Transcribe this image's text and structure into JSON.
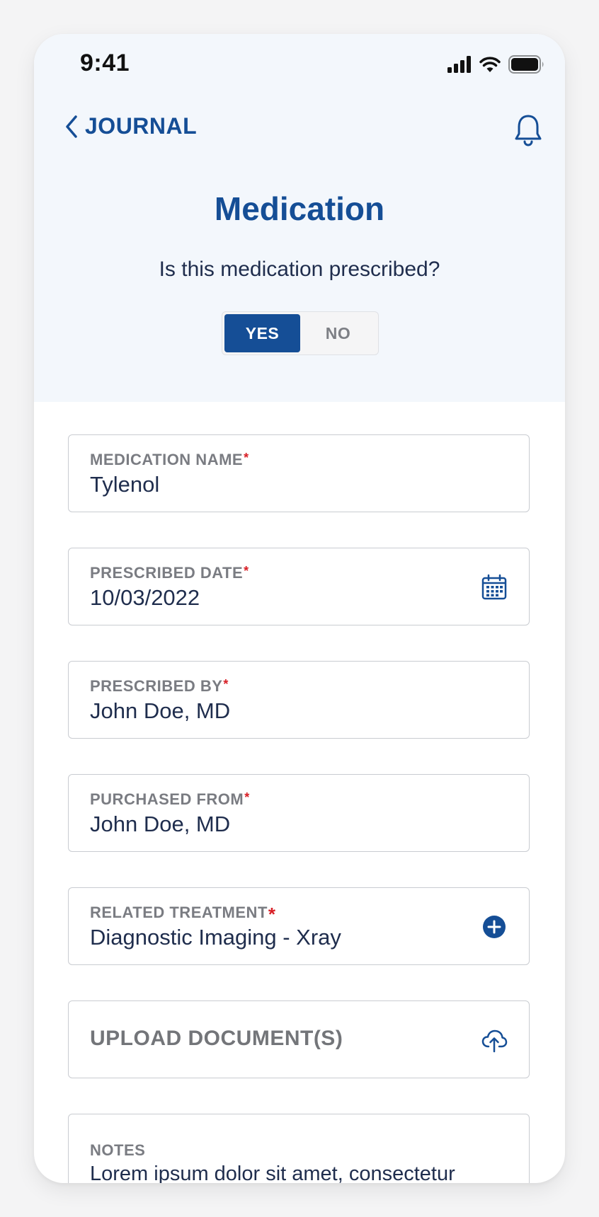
{
  "status_bar": {
    "time": "9:41",
    "icons": [
      "cellular-signal-icon",
      "wifi-icon",
      "battery-icon"
    ]
  },
  "nav": {
    "back_label": "JOURNAL",
    "back_icon": "chevron-left-icon",
    "notification_icon": "bell-icon"
  },
  "page": {
    "title": "Medication",
    "question": "Is this medication prescribed?"
  },
  "prescribed_toggle": {
    "yes_label": "YES",
    "no_label": "NO",
    "selected": "YES"
  },
  "form": {
    "medication_name": {
      "label": "MEDICATION NAME",
      "required": "*",
      "value": "Tylenol"
    },
    "prescribed_date": {
      "label": "PRESCRIBED DATE",
      "required": "*",
      "value": "10/03/2022",
      "icon": "calendar-icon"
    },
    "prescribed_by": {
      "label": "PRESCRIBED BY",
      "required": "*",
      "value": "John Doe, MD"
    },
    "purchased_from": {
      "label": "PURCHASED FROM",
      "required": "*",
      "value": "John Doe, MD"
    },
    "related_treatment": {
      "label": "RELATED TREATMENT",
      "required": "*",
      "value": "Diagnostic Imaging - Xray",
      "icon": "add-circle-icon"
    },
    "upload": {
      "label": "UPLOAD DOCUMENT(S)",
      "icon": "cloud-upload-icon"
    },
    "notes": {
      "label": "NOTES",
      "value": "Lorem ipsum dolor sit amet, consectetur"
    }
  },
  "colors": {
    "primary": "#154e96",
    "header_bg": "#f3f7fc",
    "required": "#d81f26",
    "text": "#1f2d4d",
    "label": "#7a7c82"
  }
}
